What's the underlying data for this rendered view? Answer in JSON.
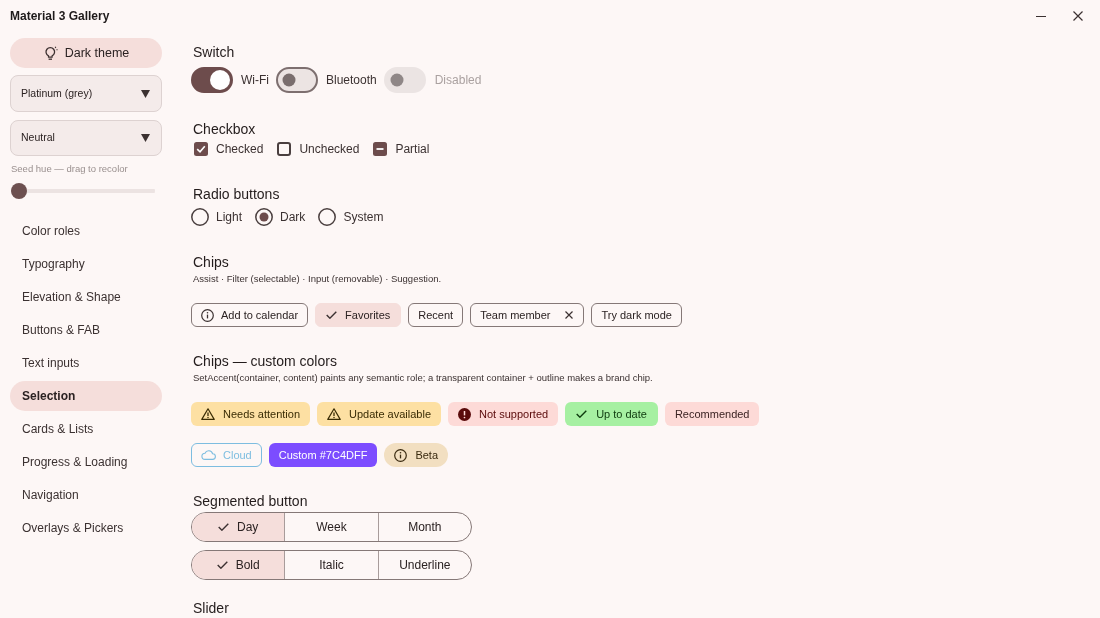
{
  "window": {
    "title": "Material 3 Gallery"
  },
  "sidebar": {
    "theme_button": {
      "label": "Dark theme"
    },
    "dropdowns": [
      {
        "value": "Platinum (grey)"
      },
      {
        "value": "Neutral"
      }
    ],
    "seed_hue": {
      "label": "Seed hue — drag to recolor",
      "level": 0
    },
    "nav_items": [
      {
        "label": "Color roles",
        "selected": false
      },
      {
        "label": "Typography",
        "selected": false
      },
      {
        "label": "Elevation & Shape",
        "selected": false
      },
      {
        "label": "Buttons & FAB",
        "selected": false
      },
      {
        "label": "Text inputs",
        "selected": false
      },
      {
        "label": "Selection",
        "selected": true
      },
      {
        "label": "Cards & Lists",
        "selected": false
      },
      {
        "label": "Progress & Loading",
        "selected": false
      },
      {
        "label": "Navigation",
        "selected": false
      },
      {
        "label": "Overlays & Pickers",
        "selected": false
      }
    ]
  },
  "switches": {
    "title": "Switch",
    "items": [
      {
        "label": "Wi-Fi",
        "on": true,
        "disabled": false
      },
      {
        "label": "Bluetooth",
        "on": false,
        "disabled": false
      },
      {
        "label": "Disabled",
        "on": false,
        "disabled": true
      }
    ]
  },
  "checkboxes": {
    "title": "Checkbox",
    "items": [
      {
        "label": "Checked",
        "checked": true,
        "indeterminate": false
      },
      {
        "label": "Unchecked",
        "checked": false,
        "indeterminate": false
      },
      {
        "label": "Partial",
        "checked": true,
        "indeterminate": true
      }
    ]
  },
  "radio_buttons": {
    "title": "Radio buttons",
    "items": [
      {
        "label": "Light",
        "selected": false
      },
      {
        "label": "Dark",
        "selected": true
      },
      {
        "label": "System",
        "selected": false
      }
    ]
  },
  "chips": {
    "title": "Chips",
    "description": "Assist · Filter (selectable) · Input (removable) · Suggestion.",
    "items": [
      {
        "kind": "assist",
        "label": "Add to calendar"
      },
      {
        "kind": "filter",
        "label": "Favorites",
        "selected": true
      },
      {
        "kind": "filter",
        "label": "Recent",
        "selected": false
      },
      {
        "kind": "input",
        "label": "Team member"
      },
      {
        "kind": "suggestion",
        "label": "Try dark mode"
      }
    ]
  },
  "custom_chips": {
    "title": "Chips — custom colors",
    "description": "SetAccent(container, content) paints any semantic role; a transparent container + outline makes a brand chip.",
    "items": [
      {
        "kind": "warning",
        "label": "Needs attention",
        "color": "#fde0a3"
      },
      {
        "kind": "warning",
        "label": "Update available",
        "color": "#fde0a3"
      },
      {
        "kind": "error",
        "label": "Not supported",
        "color": "#fddad7"
      },
      {
        "kind": "success",
        "label": "Up to date",
        "color": "#a6f0a2"
      },
      {
        "kind": "plain",
        "label": "Recommended",
        "color": "#fddad7"
      },
      {
        "kind": "brand",
        "label": "Cloud",
        "color": "#7dbde0"
      },
      {
        "kind": "plain",
        "label": "Custom #7C4DFF",
        "color": "#7c4dff"
      },
      {
        "kind": "info",
        "label": "Beta",
        "color": "#f2dfc1"
      }
    ]
  },
  "segmented": {
    "title": "Segmented button",
    "groups": [
      [
        {
          "label": "Day",
          "selected": true
        },
        {
          "label": "Week",
          "selected": false
        },
        {
          "label": "Month",
          "selected": false
        }
      ],
      [
        {
          "label": "Bold",
          "selected": true
        },
        {
          "label": "Italic",
          "selected": false
        },
        {
          "label": "Underline",
          "selected": false
        }
      ]
    ]
  },
  "slider": {
    "title": "Slider"
  }
}
